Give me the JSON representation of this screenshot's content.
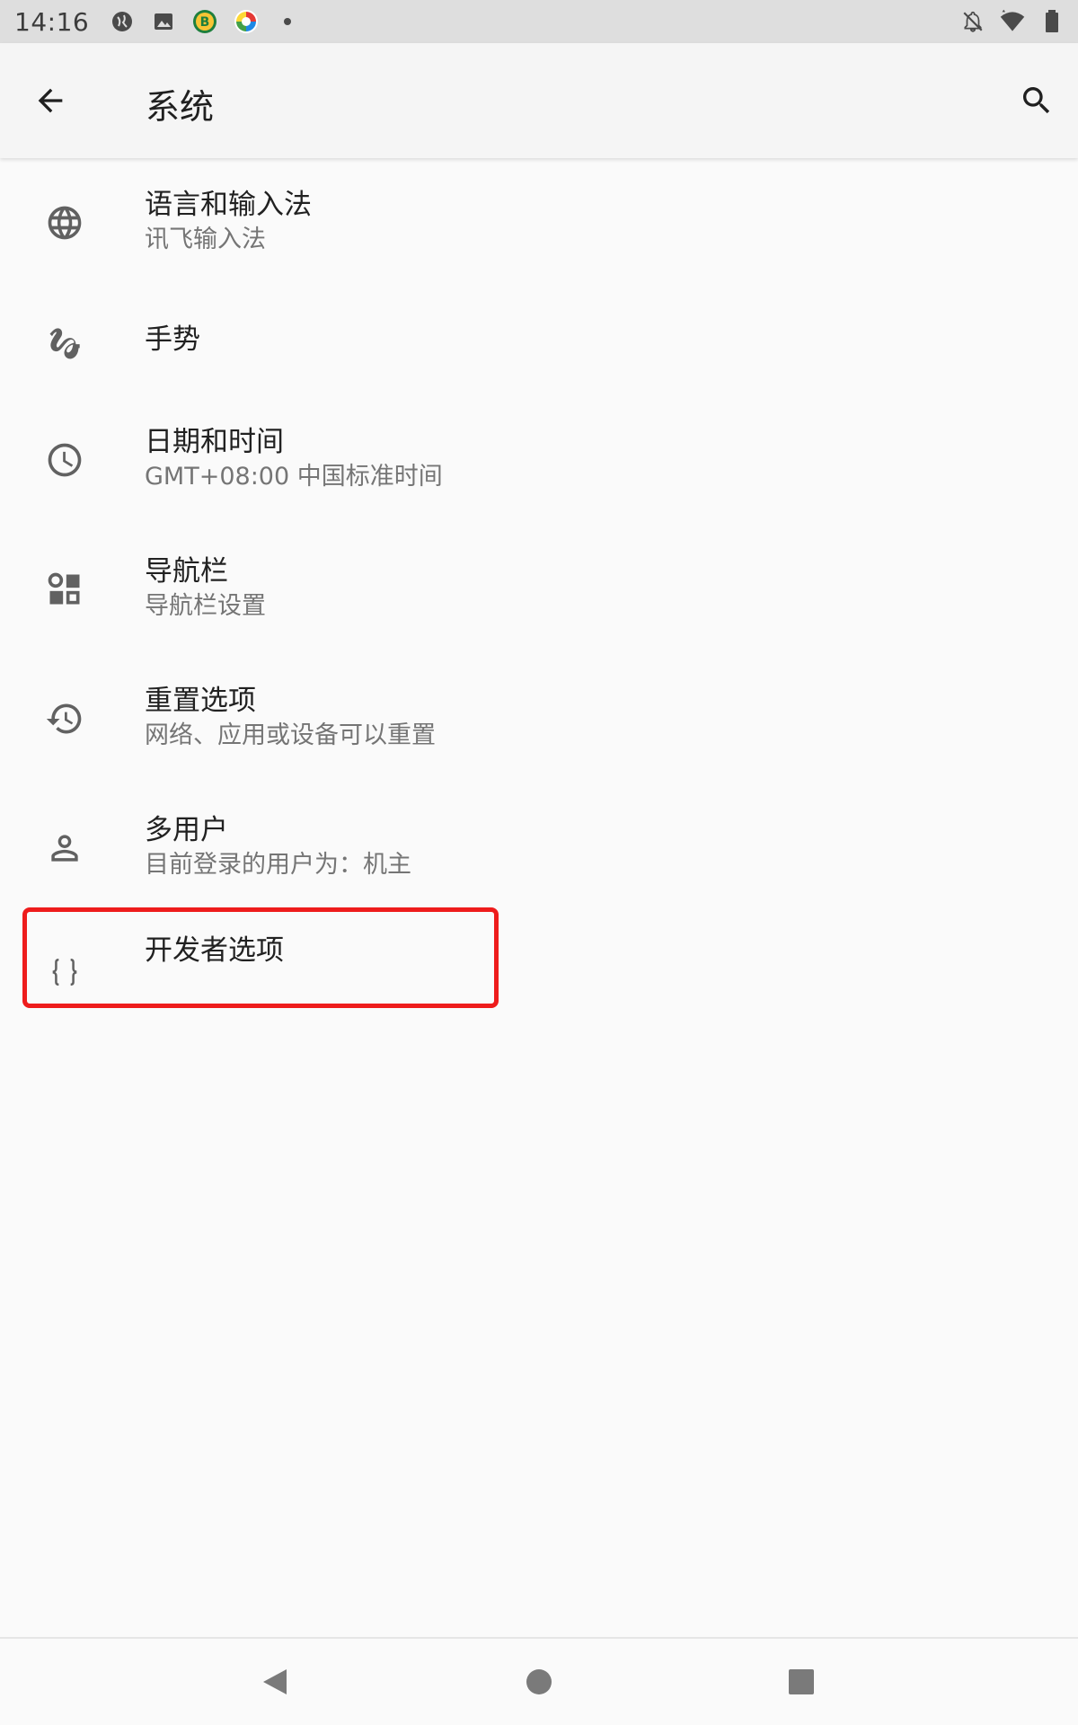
{
  "status_bar": {
    "time": "14:16",
    "left_icons": [
      "app-icon-globe-drop",
      "image-icon",
      "bitcoin-app-icon",
      "colorful-app-icon",
      "more-dot-icon"
    ],
    "right_icons": [
      "notifications-off-icon",
      "wifi-icon",
      "battery-icon"
    ]
  },
  "app_bar": {
    "title": "系统",
    "back_icon": "arrow-back-icon",
    "search_icon": "search-icon"
  },
  "items": [
    {
      "title": "语言和输入法",
      "subtitle": "讯飞输入法",
      "icon": "globe-icon"
    },
    {
      "title": "手势",
      "subtitle": "",
      "icon": "gesture-icon"
    },
    {
      "title": "日期和时间",
      "subtitle": "GMT+08:00 中国标准时间",
      "icon": "clock-icon"
    },
    {
      "title": "导航栏",
      "subtitle": "导航栏设置",
      "icon": "dashboard-icon"
    },
    {
      "title": "重置选项",
      "subtitle": "网络、应用或设备可以重置",
      "icon": "history-icon"
    },
    {
      "title": "多用户",
      "subtitle": "目前登录的用户为：机主",
      "icon": "person-icon"
    },
    {
      "title": "开发者选项",
      "subtitle": "",
      "icon": "code-braces-icon"
    }
  ],
  "nav_bar": {
    "back": "back-triangle-icon",
    "home": "home-circle-icon",
    "recents": "recents-square-icon"
  },
  "colors": {
    "highlight": "#ee1c1c",
    "icon_gray": "#616161"
  }
}
